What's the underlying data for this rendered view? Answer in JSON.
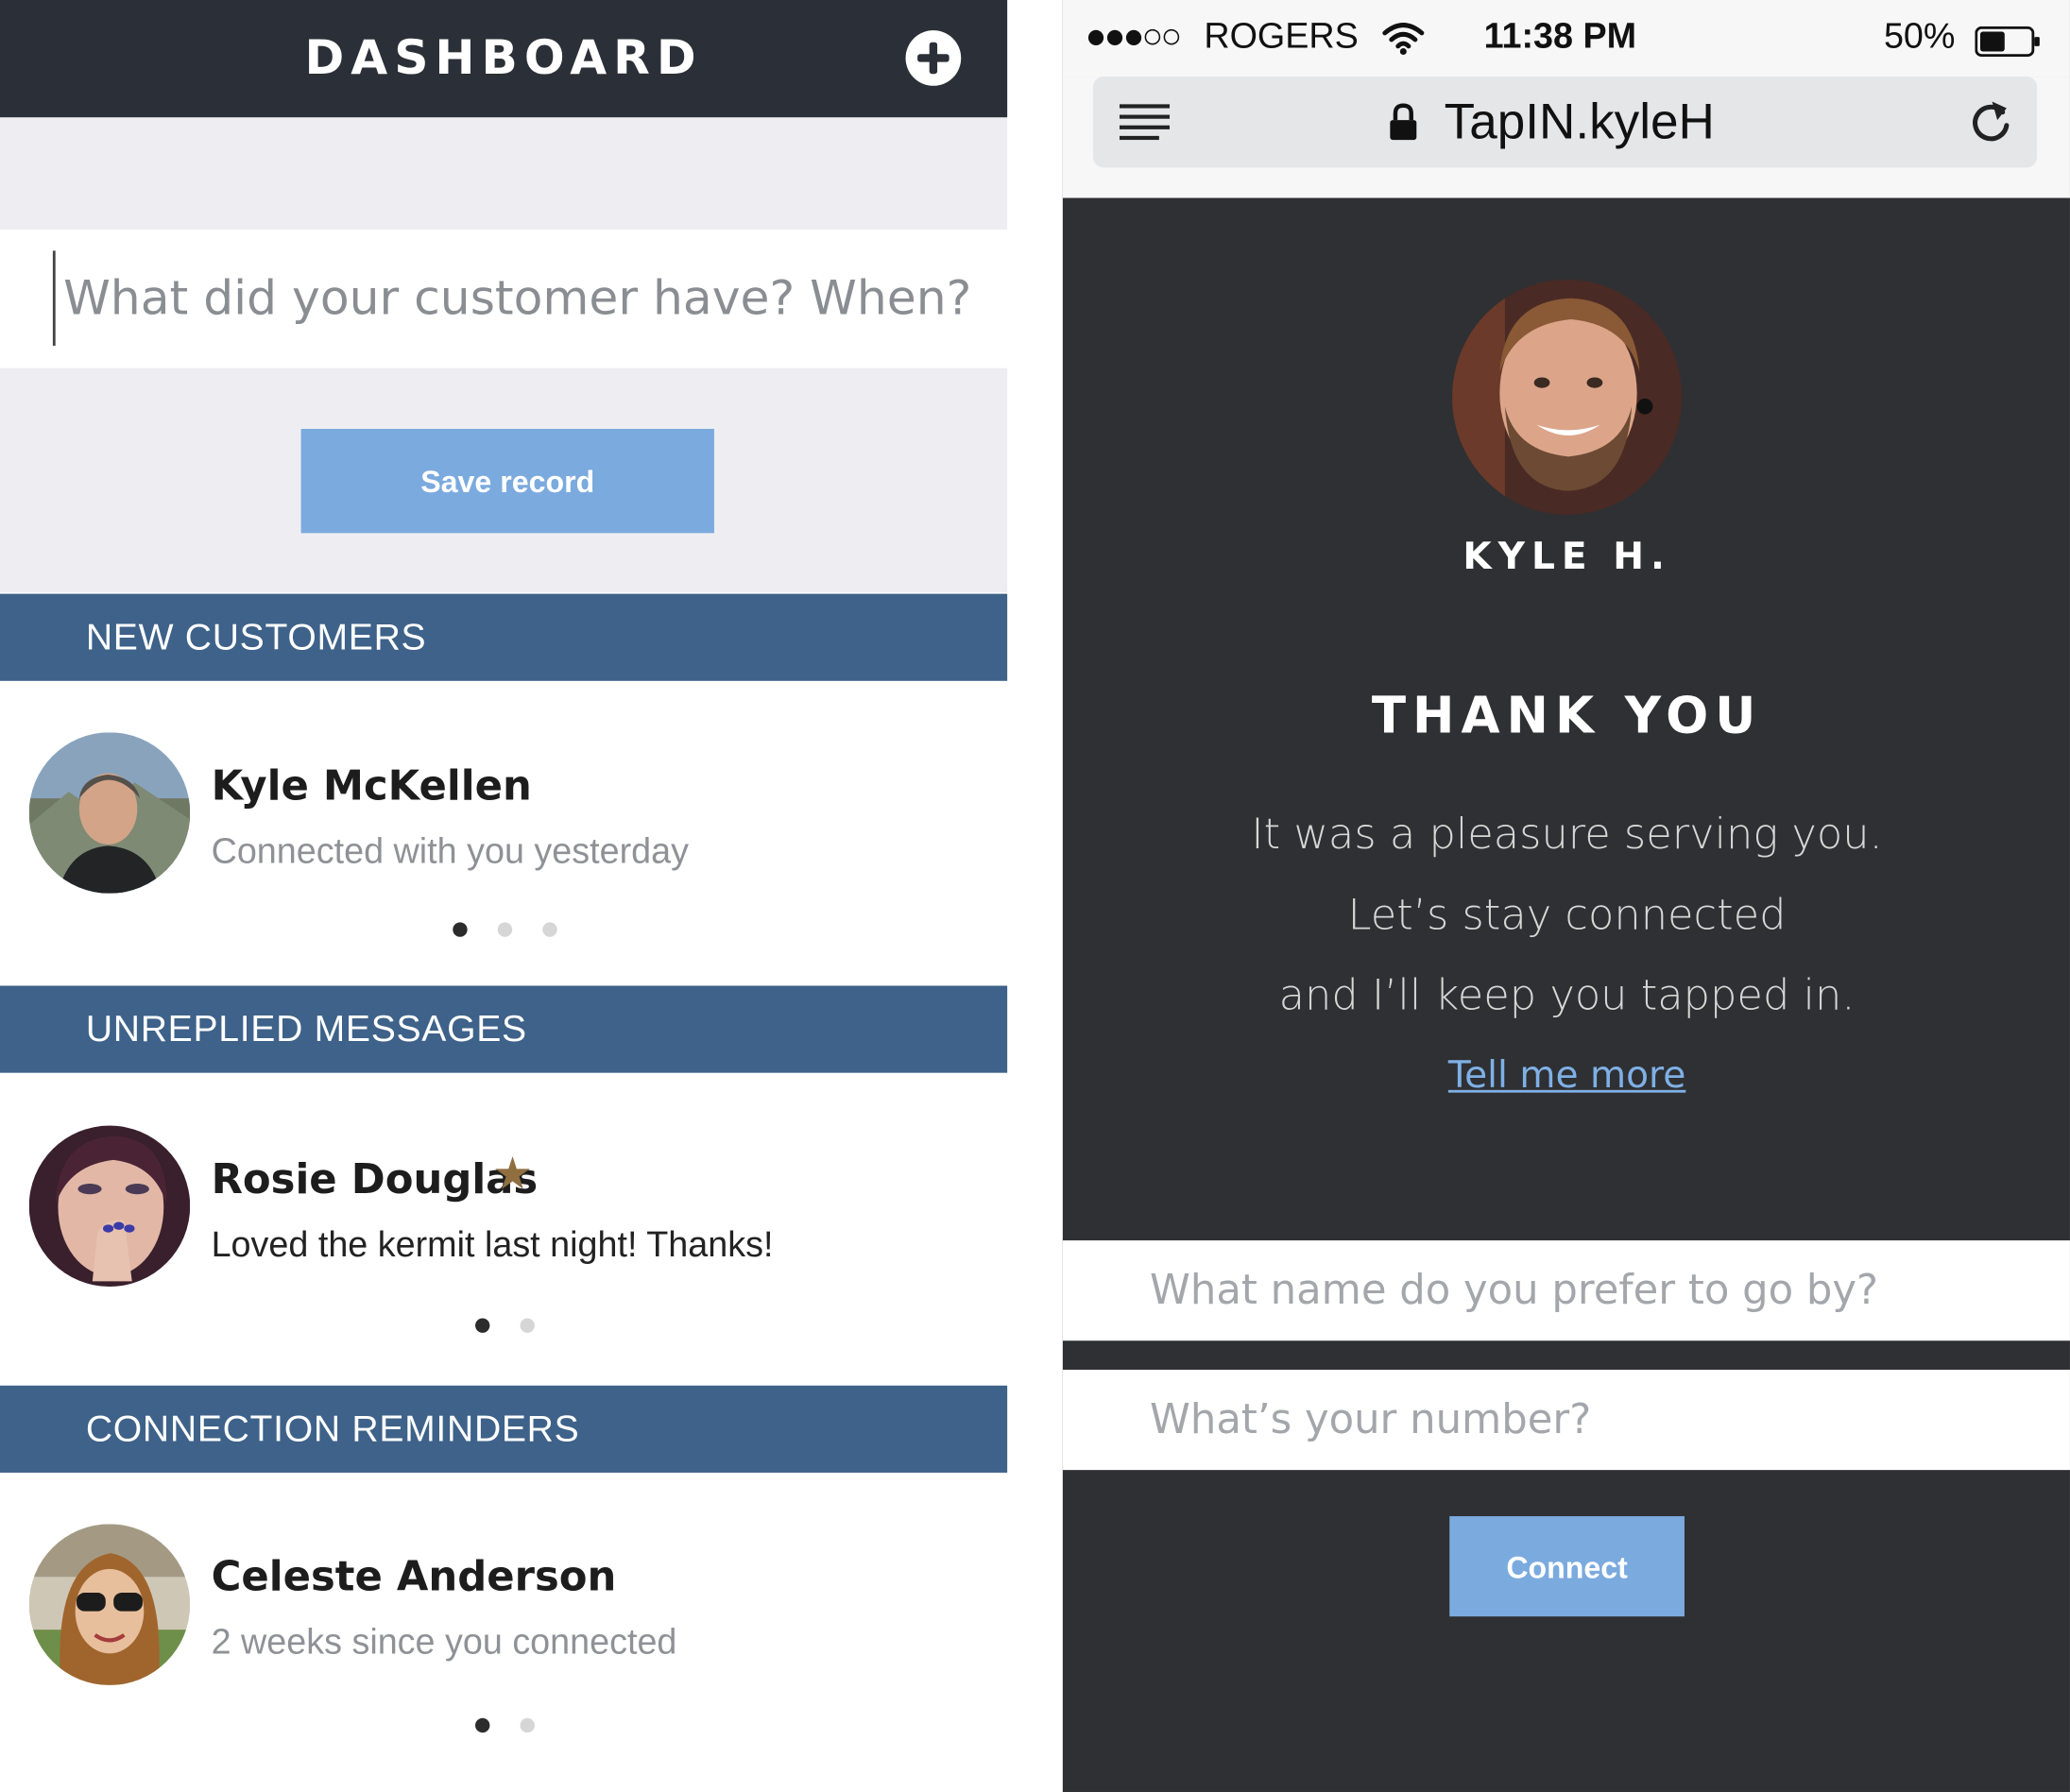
{
  "dashboard": {
    "title": "DASHBOARD",
    "add_icon": "plus-circle-icon",
    "record_input_placeholder": "What did your customer have? When?",
    "save_button": "Save record"
  },
  "sections": [
    {
      "header": "NEW CUSTOMERS",
      "name": "Kyle McKellen",
      "subtitle": "Connected with you yesterday",
      "pager": {
        "total": 3,
        "active": 1
      }
    },
    {
      "header": "UNREPLIED MESSAGES",
      "name": "Rosie Douglas",
      "starred": true,
      "star_icon": "star-icon",
      "subtitle": "Loved the kermit last night! Thanks!",
      "pager": {
        "total": 2,
        "active": 1
      }
    },
    {
      "header": "CONNECTION REMINDERS",
      "name": "Celeste Anderson",
      "subtitle": "2 weeks since you connected",
      "pager": {
        "total": 2,
        "active": 1
      }
    }
  ],
  "phone": {
    "status": {
      "signal": "●●●○○",
      "carrier": "ROGERS",
      "time": "11:38 PM",
      "battery": "50%",
      "battery_level": 0.5
    },
    "browser": {
      "url": "TapIN.kyleH",
      "menu_icon": "menu-icon",
      "lock_icon": "lock-icon",
      "reload_icon": "reload-icon"
    },
    "profile": {
      "name": "KYLE H.",
      "heading": "THANK YOU",
      "lines": [
        "It was a pleasure serving you.",
        "Let’s stay connected",
        "and I’ll keep you tapped in."
      ],
      "link": "Tell me more"
    },
    "form": {
      "name_placeholder": "What name do you prefer to go by?",
      "number_placeholder": "What’s your number?",
      "connect_button": "Connect"
    }
  },
  "colors": {
    "topbar": "#2b3038",
    "section_header": "#3e6289",
    "button": "#7baade",
    "star": "#8f6e40",
    "phone_bg": "#2f3033",
    "link": "#7fb0e6"
  }
}
